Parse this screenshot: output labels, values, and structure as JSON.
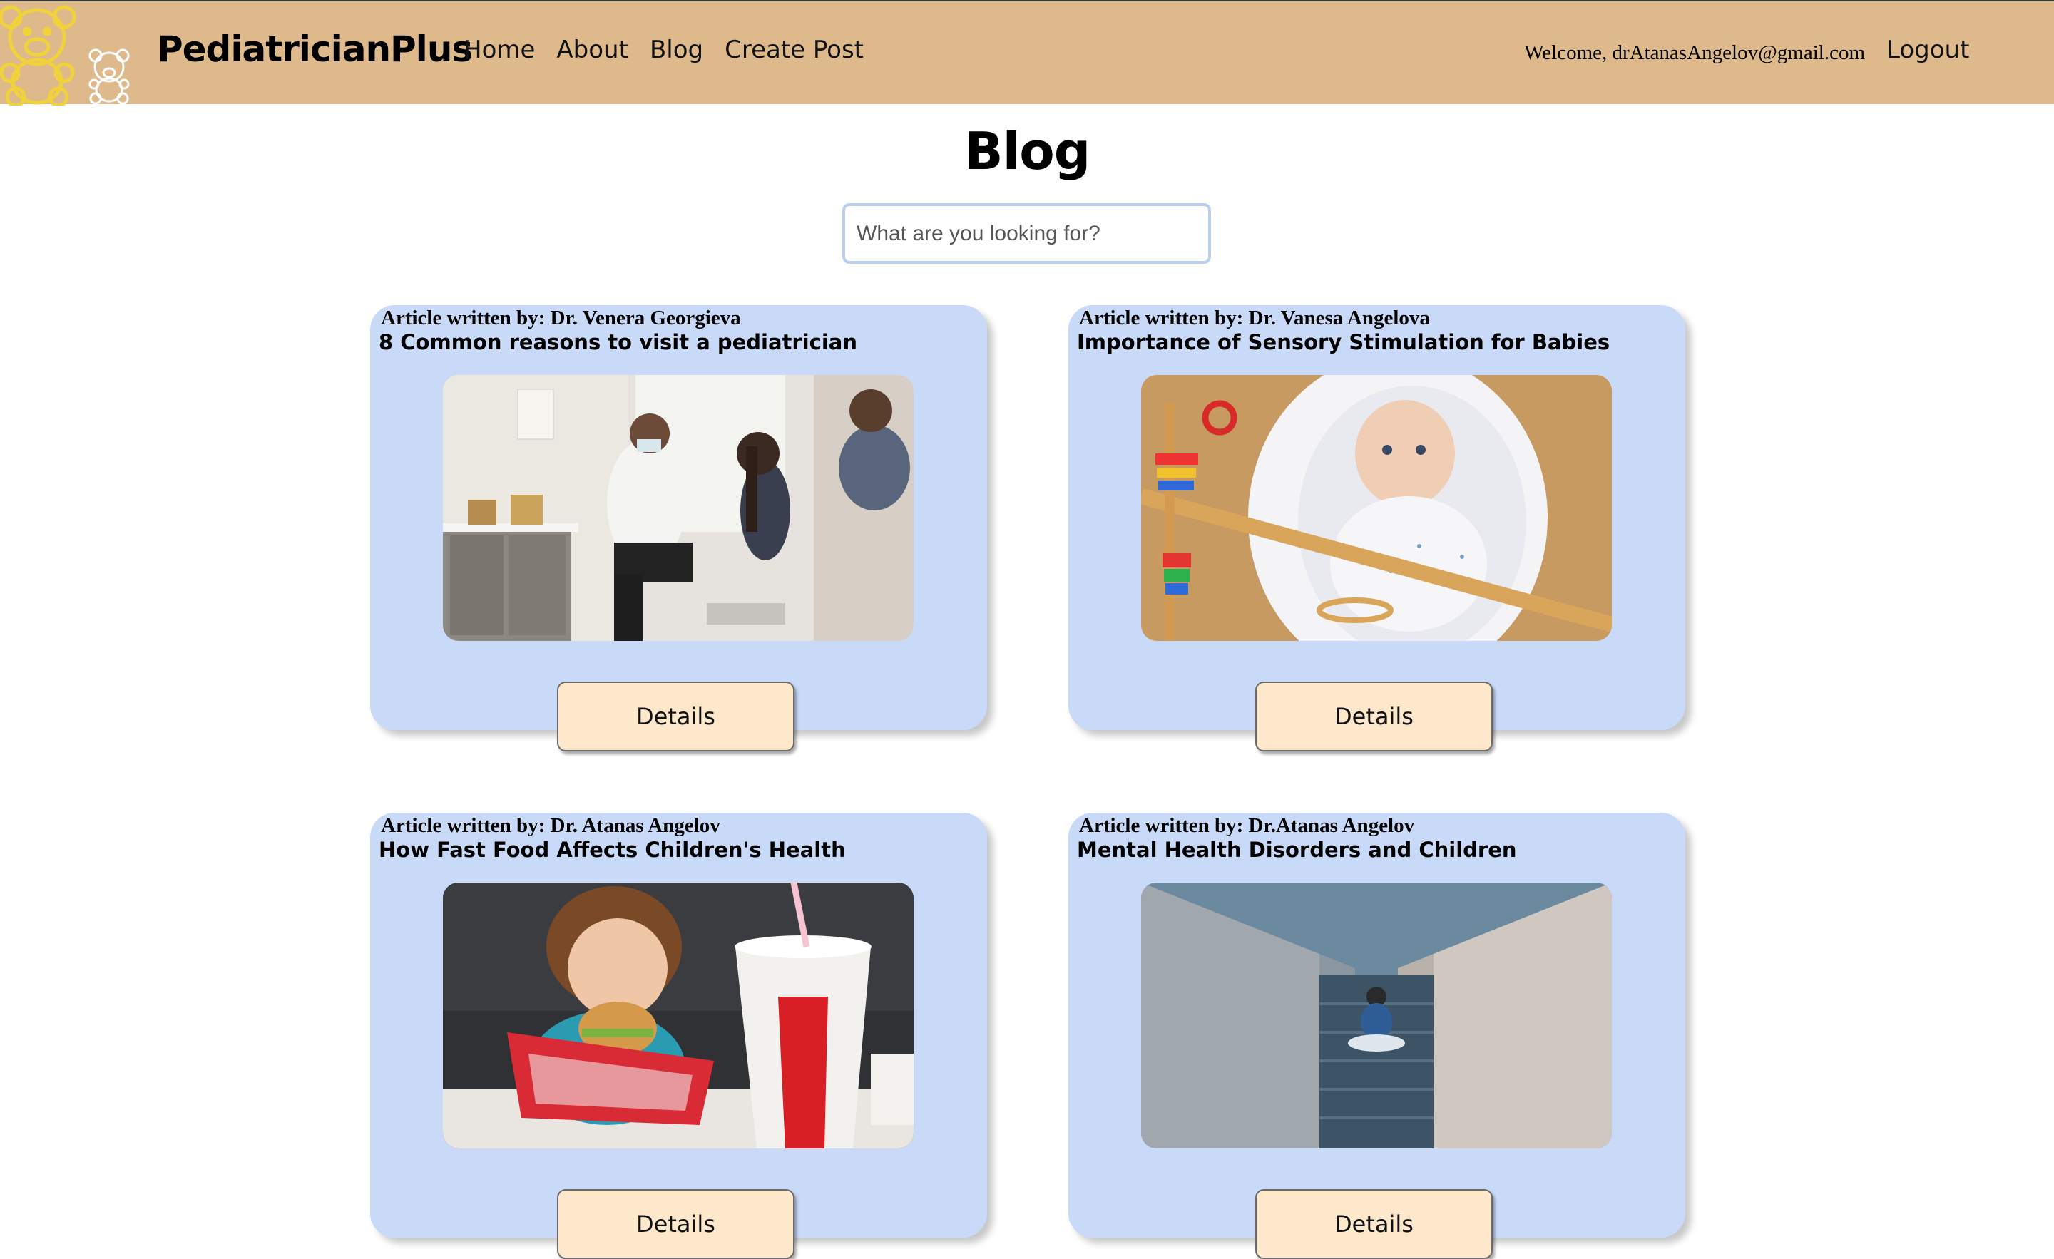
{
  "nav": {
    "brand": "PediatricianPlus",
    "links": [
      "Home",
      "About",
      "Blog",
      "Create Post"
    ],
    "welcome": "Welcome, drAtanasAngelov@gmail.com",
    "logout": "Logout",
    "logo_icons": [
      "teddy-bear-logo-icon",
      "teddy-bear-small-icon"
    ]
  },
  "main": {
    "title": "Blog",
    "search_placeholder": "What are you looking for?"
  },
  "posts": [
    {
      "author": "Article written by: Dr. Venera Georgieva",
      "title": "8 Common reasons to visit a pediatrician",
      "image": "doctor-visit-photo",
      "button": "Details"
    },
    {
      "author": "Article written by: Dr. Vanesa Angelova",
      "title": "Importance of Sensory Stimulation for Babies",
      "image": "baby-photo",
      "button": "Details"
    },
    {
      "author": "Article written by: Dr. Atanas Angelov",
      "title": "How Fast Food Affects Children's Health",
      "image": "child-eating-burger-photo",
      "button": "Details"
    },
    {
      "author": "Article written by: Dr.Atanas Angelov",
      "title": "Mental Health Disorders and Children",
      "image": "child-on-stairs-photo",
      "button": "Details"
    }
  ],
  "colors": {
    "navbar": "#deb98c",
    "card": "#c9daf8",
    "button": "#fde8cc",
    "search_border": "#b8cfee"
  }
}
